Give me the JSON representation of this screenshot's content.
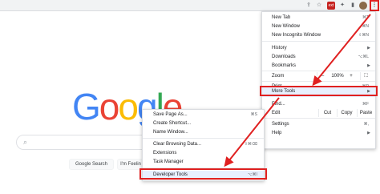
{
  "toolbar": {
    "icons": [
      "share-icon",
      "star-icon",
      "extension-red-icon",
      "puzzle-icon",
      "sidebar-icon",
      "avatar",
      "kebab-menu-icon"
    ],
    "ext_label": "ext"
  },
  "google": {
    "logo_letters": [
      "G",
      "o",
      "o",
      "g",
      "l",
      "e"
    ],
    "logo_colors": [
      "#4285f4",
      "#ea4335",
      "#fbbc05",
      "#4285f4",
      "#34a853",
      "#ea4335"
    ],
    "search_button": "Google Search",
    "lucky_button": "I'm Feelin"
  },
  "menu": {
    "new_tab": "New Tab",
    "new_tab_sc": "⌘T",
    "new_window": "New Window",
    "new_window_sc": "⌘N",
    "new_incognito": "New Incognito Window",
    "new_incognito_sc": "⇧⌘N",
    "history": "History",
    "downloads": "Downloads",
    "downloads_sc": "⌥⌘L",
    "bookmarks": "Bookmarks",
    "zoom": "Zoom",
    "zoom_minus": "–",
    "zoom_value": "100%",
    "zoom_plus": "+",
    "print": "Print...",
    "print_sc": "⌘P",
    "cast": "Cast...",
    "find": "Find...",
    "find_sc": "⌘F",
    "more_tools": "More Tools",
    "edit": "Edit",
    "cut": "Cut",
    "copy": "Copy",
    "paste": "Paste",
    "settings": "Settings",
    "settings_sc": "⌘,",
    "help": "Help"
  },
  "submenu": {
    "save_page": "Save Page As...",
    "save_page_sc": "⌘S",
    "create_shortcut": "Create Shortcut...",
    "name_window": "Name Window...",
    "clear_browsing": "Clear Browsing Data...",
    "clear_browsing_sc": "⇧⌘⌫",
    "extensions": "Extensions",
    "task_manager": "Task Manager",
    "developer_tools": "Developer Tools",
    "developer_tools_sc": "⌥⌘I"
  },
  "colors": {
    "highlight_red": "#e02020",
    "menu_hover": "#e8f0fe"
  }
}
